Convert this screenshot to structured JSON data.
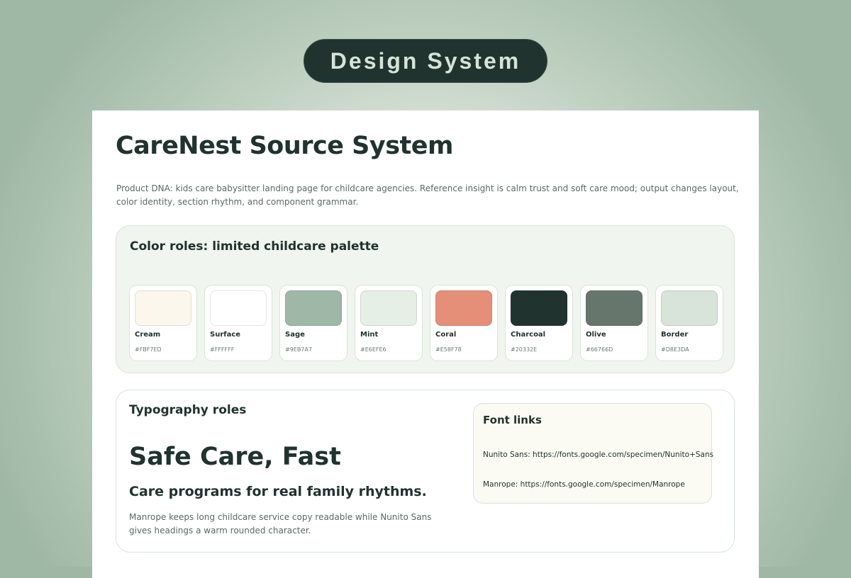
{
  "header": {
    "pill_label": "Design System"
  },
  "page": {
    "title": "CareNest Source System",
    "description": "Product DNA: kids care babysitter landing page for childcare agencies. Reference insight is calm trust and soft care mood; output changes layout, color identity, section rhythm, and component grammar."
  },
  "palette": {
    "heading": "Color roles: limited childcare palette",
    "swatches": [
      {
        "name": "Cream",
        "hex": "#FBF7ED",
        "color": "#FBF7ED"
      },
      {
        "name": "Surface",
        "hex": "#FFFFFF",
        "color": "#FFFFFF"
      },
      {
        "name": "Sage",
        "hex": "#9EB7A7",
        "color": "#9EB7A7"
      },
      {
        "name": "Mint",
        "hex": "#E6EFE6",
        "color": "#E6EFE6"
      },
      {
        "name": "Coral",
        "hex": "#E58F78",
        "color": "#E58F78"
      },
      {
        "name": "Charcoal",
        "hex": "#20332E",
        "color": "#20332E"
      },
      {
        "name": "Olive",
        "hex": "#66766D",
        "color": "#66766D"
      },
      {
        "name": "Border",
        "hex": "#D8E3DA",
        "color": "#D8E3DA"
      }
    ]
  },
  "typography": {
    "heading": "Typography roles",
    "display_sample": "Safe Care, Fast",
    "subhead_sample": "Care programs for real family rhythms.",
    "body_sample": "Manrope keeps long childcare service copy readable while Nunito Sans gives headings a warm rounded character.",
    "font_links": {
      "heading": "Font links",
      "links": [
        "Nunito Sans: https://fonts.google.com/specimen/Nunito+Sans",
        "Manrope: https://fonts.google.com/specimen/Manrope"
      ]
    }
  },
  "colors": {
    "background": "#9EB7A7",
    "pill": "#20332E",
    "panel": "#F1F5EF",
    "border": "#D8E3DA"
  }
}
